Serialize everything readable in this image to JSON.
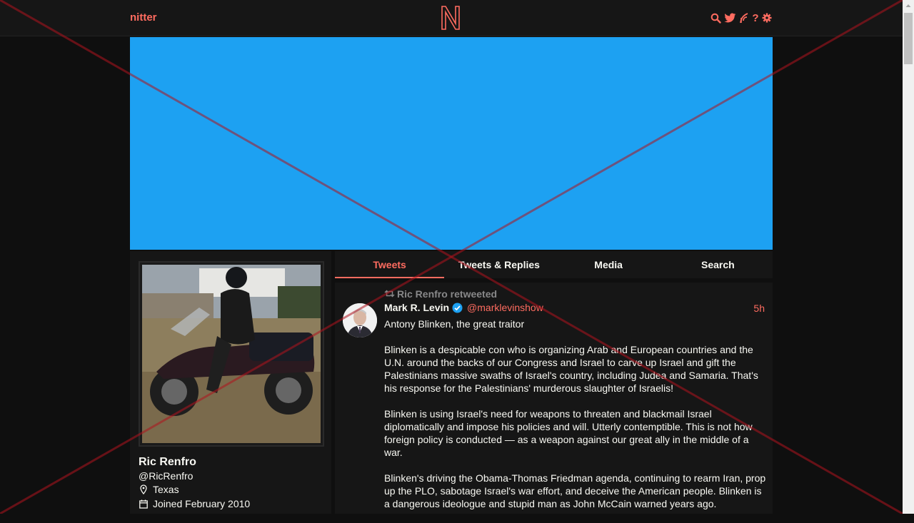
{
  "navbar": {
    "brand": "nitter",
    "logo_letter": "N",
    "icons": [
      "search-icon",
      "twitter-bird-icon",
      "rss-icon",
      "help-icon",
      "settings-icon"
    ]
  },
  "colors": {
    "accent": "#ff6c60",
    "banner": "#1da1f2",
    "background": "#0f0f0f",
    "panel": "#161616",
    "verified": "#1da1f2"
  },
  "profile": {
    "fullname": "Ric Renfro",
    "username": "@RicRenfro",
    "location": "Texas",
    "joined": "Joined February 2010"
  },
  "tabs": [
    {
      "label": "Tweets",
      "active": true
    },
    {
      "label": "Tweets & Replies",
      "active": false
    },
    {
      "label": "Media",
      "active": false
    },
    {
      "label": "Search",
      "active": false
    }
  ],
  "tweet": {
    "retweet_header": "Ric Renfro retweeted",
    "fullname": "Mark R. Levin",
    "username": "@marklevinshow",
    "verified": true,
    "date": "5h",
    "paragraphs": [
      "Antony Blinken, the great traitor",
      "Blinken is a despicable con who is organizing Arab and European countries and the U.N. around the backs of our Congress and Israel to carve up Israel and gift the Palestinians massive swaths of Israel's country, including Judea and Samaria.  That's his response for the Palestinians' murderous slaughter of Israelis!",
      "Blinken is using Israel's need for weapons to threaten and blackmail Israel diplomatically and impose his policies and will. Utterly contemptible. This is not how foreign policy is conducted — as a weapon against our great ally in the middle of a war.",
      "Blinken's driving the Obama-Thomas Friedman agenda, continuing to rearm Iran, prop up the PLO, sabotage Israel's war effort, and deceive the American people. Blinken is a dangerous ideologue and stupid man as John McCain warned years ago."
    ]
  }
}
